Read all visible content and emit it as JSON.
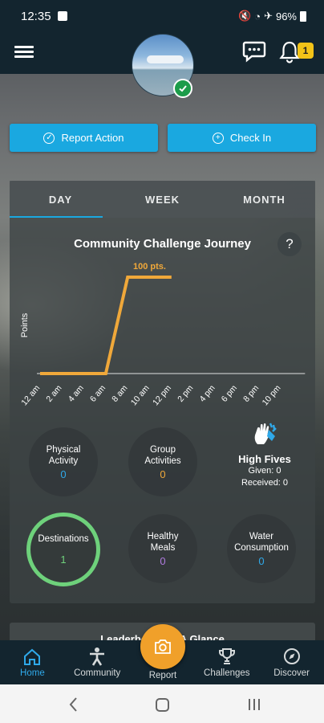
{
  "status_bar": {
    "time": "12:35",
    "battery": "96%"
  },
  "app_bar": {
    "notification_count": "1"
  },
  "actions": {
    "report_action": "Report Action",
    "check_in": "Check In"
  },
  "tabs": [
    {
      "label": "DAY"
    },
    {
      "label": "WEEK"
    },
    {
      "label": "MONTH"
    }
  ],
  "chart": {
    "title": "Community Challenge Journey",
    "help": "?",
    "peak_label": "100 pts."
  },
  "chart_data": {
    "type": "line",
    "title": "Community Challenge Journey",
    "ylabel": "Points",
    "x": [
      "12 am",
      "2 am",
      "4 am",
      "6 am",
      "8 am",
      "10 am",
      "12 pm",
      "2 pm",
      "4 pm",
      "6 pm",
      "8 pm",
      "10 pm"
    ],
    "series": [
      {
        "values": [
          0,
          0,
          0,
          0,
          100,
          100,
          100,
          null,
          null,
          null,
          null,
          null
        ]
      }
    ],
    "annotations": [
      "100 pts."
    ],
    "ylim": [
      0,
      100
    ],
    "color": "#f0a83a"
  },
  "stats": {
    "physical": {
      "label1": "Physical",
      "label2": "Activity",
      "value": "0",
      "color": "#2fa9ea"
    },
    "group": {
      "label1": "Group",
      "label2": "Activities",
      "value": "0",
      "color": "#f0a83a"
    },
    "destinations": {
      "label": "Destinations",
      "value": "1",
      "color": "#6ed17b"
    },
    "meals": {
      "label1": "Healthy",
      "label2": "Meals",
      "value": "0",
      "color": "#b07be0"
    },
    "water": {
      "label1": "Water",
      "label2": "Consumption",
      "value": "0",
      "color": "#2fa9ea"
    }
  },
  "high_fives": {
    "title": "High Fives",
    "given": "Given: 0",
    "received": "Received: 0"
  },
  "next_card": {
    "title": "Leaderboard At A Glance"
  },
  "bottom_nav": {
    "home": "Home",
    "community": "Community",
    "report": "Report",
    "challenges": "Challenges",
    "discover": "Discover"
  }
}
